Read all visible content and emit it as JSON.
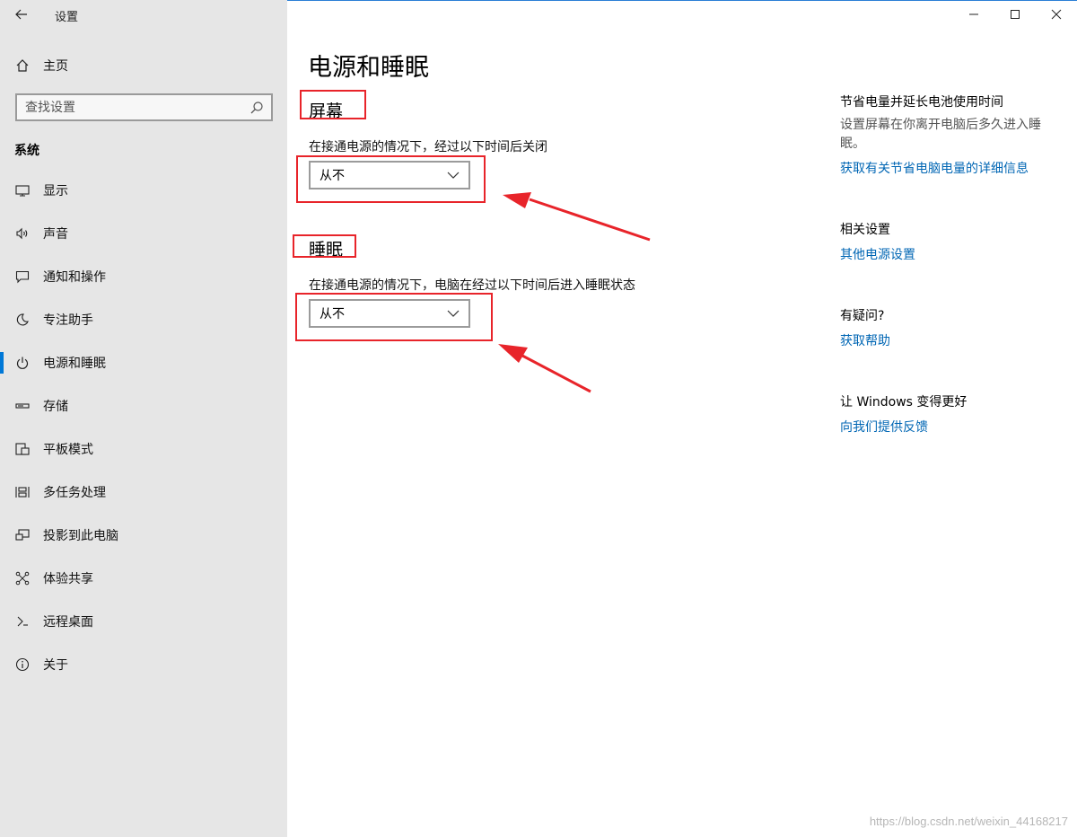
{
  "window": {
    "app_title": "设置",
    "controls": [
      "minimize",
      "maximize",
      "close"
    ]
  },
  "sidebar": {
    "home_label": "主页",
    "search_placeholder": "查找设置",
    "section_header": "系统",
    "items": [
      {
        "label": "显示",
        "icon": "monitor-icon"
      },
      {
        "label": "声音",
        "icon": "speaker-icon"
      },
      {
        "label": "通知和操作",
        "icon": "notification-icon"
      },
      {
        "label": "专注助手",
        "icon": "moon-icon"
      },
      {
        "label": "电源和睡眠",
        "icon": "power-icon",
        "active": true
      },
      {
        "label": "存储",
        "icon": "storage-icon"
      },
      {
        "label": "平板模式",
        "icon": "tablet-icon"
      },
      {
        "label": "多任务处理",
        "icon": "multitask-icon"
      },
      {
        "label": "投影到此电脑",
        "icon": "project-icon"
      },
      {
        "label": "体验共享",
        "icon": "share-icon"
      },
      {
        "label": "远程桌面",
        "icon": "remote-icon"
      },
      {
        "label": "关于",
        "icon": "info-icon"
      }
    ]
  },
  "main": {
    "title": "电源和睡眠",
    "screen": {
      "heading": "屏幕",
      "description": "在接通电源的情况下，经过以下时间后关闭",
      "value": "从不"
    },
    "sleep": {
      "heading": "睡眠",
      "description": "在接通电源的情况下，电脑在经过以下时间后进入睡眠状态",
      "value": "从不"
    }
  },
  "right_panel": {
    "battery": {
      "heading": "节省电量并延长电池使用时间",
      "text": "设置屏幕在你离开电脑后多久进入睡眠。",
      "link": "获取有关节省电脑电量的详细信息"
    },
    "related": {
      "heading": "相关设置",
      "link": "其他电源设置"
    },
    "help": {
      "heading": "有疑问?",
      "link": "获取帮助"
    },
    "feedback": {
      "heading": "让 Windows 变得更好",
      "link": "向我们提供反馈"
    }
  },
  "watermark": "https://blog.csdn.net/weixin_44168217",
  "colors": {
    "sidebar_bg": "#e6e6e6",
    "accent": "#0078d7",
    "link": "#0066b4",
    "annotation": "#e8242a"
  }
}
